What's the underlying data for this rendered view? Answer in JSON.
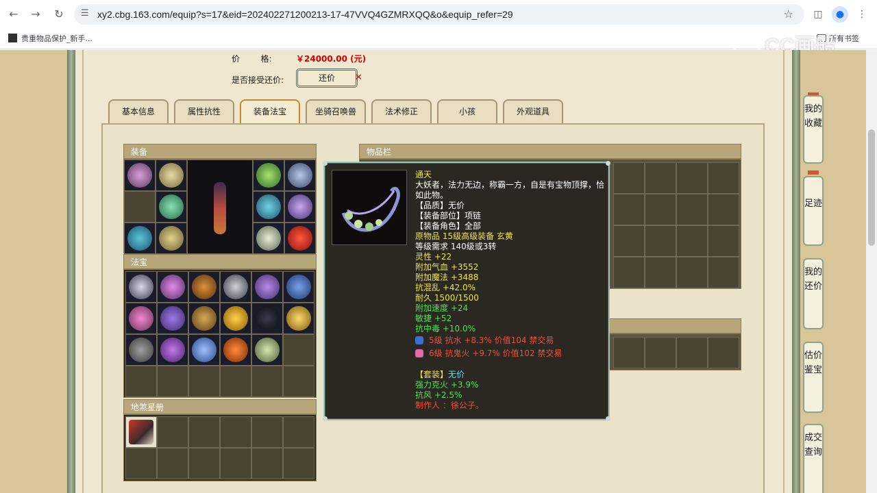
{
  "browser": {
    "url": "xy2.cbg.163.com/equip?s=17&eid=202402271200213-17-47VVQ4GZMRXQQ&o&equip_refer=29",
    "bookmark": "贵重物品保护_新手...",
    "bookmarks_folder": "所有书签",
    "watermark": "CC画船"
  },
  "price": {
    "label": "价        格:",
    "value": "￥24000.00 (元)"
  },
  "counter_offer": {
    "label": "是否接受还价:",
    "button": "还价",
    "mark": "✕"
  },
  "tabs": [
    {
      "label": "基本信息",
      "active": false
    },
    {
      "label": "属性抗性",
      "active": false
    },
    {
      "label": "装备法宝",
      "active": true
    },
    {
      "label": "坐骑召唤兽",
      "active": false
    },
    {
      "label": "法术修正",
      "active": false
    },
    {
      "label": "小孩",
      "active": false
    },
    {
      "label": "外观道具",
      "active": false
    }
  ],
  "sections": {
    "equipment": "装备",
    "fabao": "法宝",
    "disha": "地煞星册",
    "inventory": "物品栏"
  },
  "tooltip": {
    "lines": [
      {
        "text": "通天",
        "color": "yellow"
      },
      {
        "text": "大妖者，法力无边，称霸一方，自是有宝物顶撑，恰如此物。",
        "color": "white"
      },
      {
        "text": "【品质】无价",
        "color": "white"
      },
      {
        "text": "【装备部位】项链",
        "color": "white"
      },
      {
        "text": "【装备角色】全部",
        "color": "white"
      },
      {
        "text": "原物品 15级高级装备 玄黄",
        "color": "yellow"
      },
      {
        "text": "等级需求 140级或3转",
        "color": "white"
      },
      {
        "text": "灵性 +22",
        "color": "yellow"
      },
      {
        "text": "附加气血 +3552",
        "color": "yellow"
      },
      {
        "text": "附加魔法 +3488",
        "color": "yellow"
      },
      {
        "text": "抗混乱 +42.0%",
        "color": "yellow"
      },
      {
        "text": "耐久 1500/1500",
        "color": "yellow"
      },
      {
        "text": "附加速度 +24",
        "color": "green"
      },
      {
        "text": "敏捷 +52",
        "color": "green"
      },
      {
        "text": "抗中毒 +10.0%",
        "color": "green"
      }
    ],
    "gems": [
      {
        "text": "5级 抗水 +8.3% 价值104 禁交易",
        "color": "#3d6fd0"
      },
      {
        "text": "6级 抗鬼火 +9.7% 价值102 禁交易",
        "color": "#e26aa6"
      }
    ],
    "set_label": "【套装】",
    "set_value": "无价",
    "set_lines": [
      {
        "text": "强力克火 +3.9%",
        "color": "green"
      },
      {
        "text": "抗风 +2.5%",
        "color": "green"
      }
    ],
    "maker": "制作人 ：徐公子。"
  },
  "right_nav": [
    {
      "label": "我的收藏"
    },
    {
      "label": "足迹"
    },
    {
      "label": "我的还价"
    },
    {
      "label": "估价鉴宝"
    },
    {
      "label": "成交查询"
    }
  ],
  "icons": {
    "back": "arrow-left",
    "forward": "arrow-right",
    "reload": "reload",
    "site_info": "tune",
    "bookmark_star": "star",
    "sidebar": "sidebar",
    "profile": "person",
    "menu": "kebab"
  }
}
